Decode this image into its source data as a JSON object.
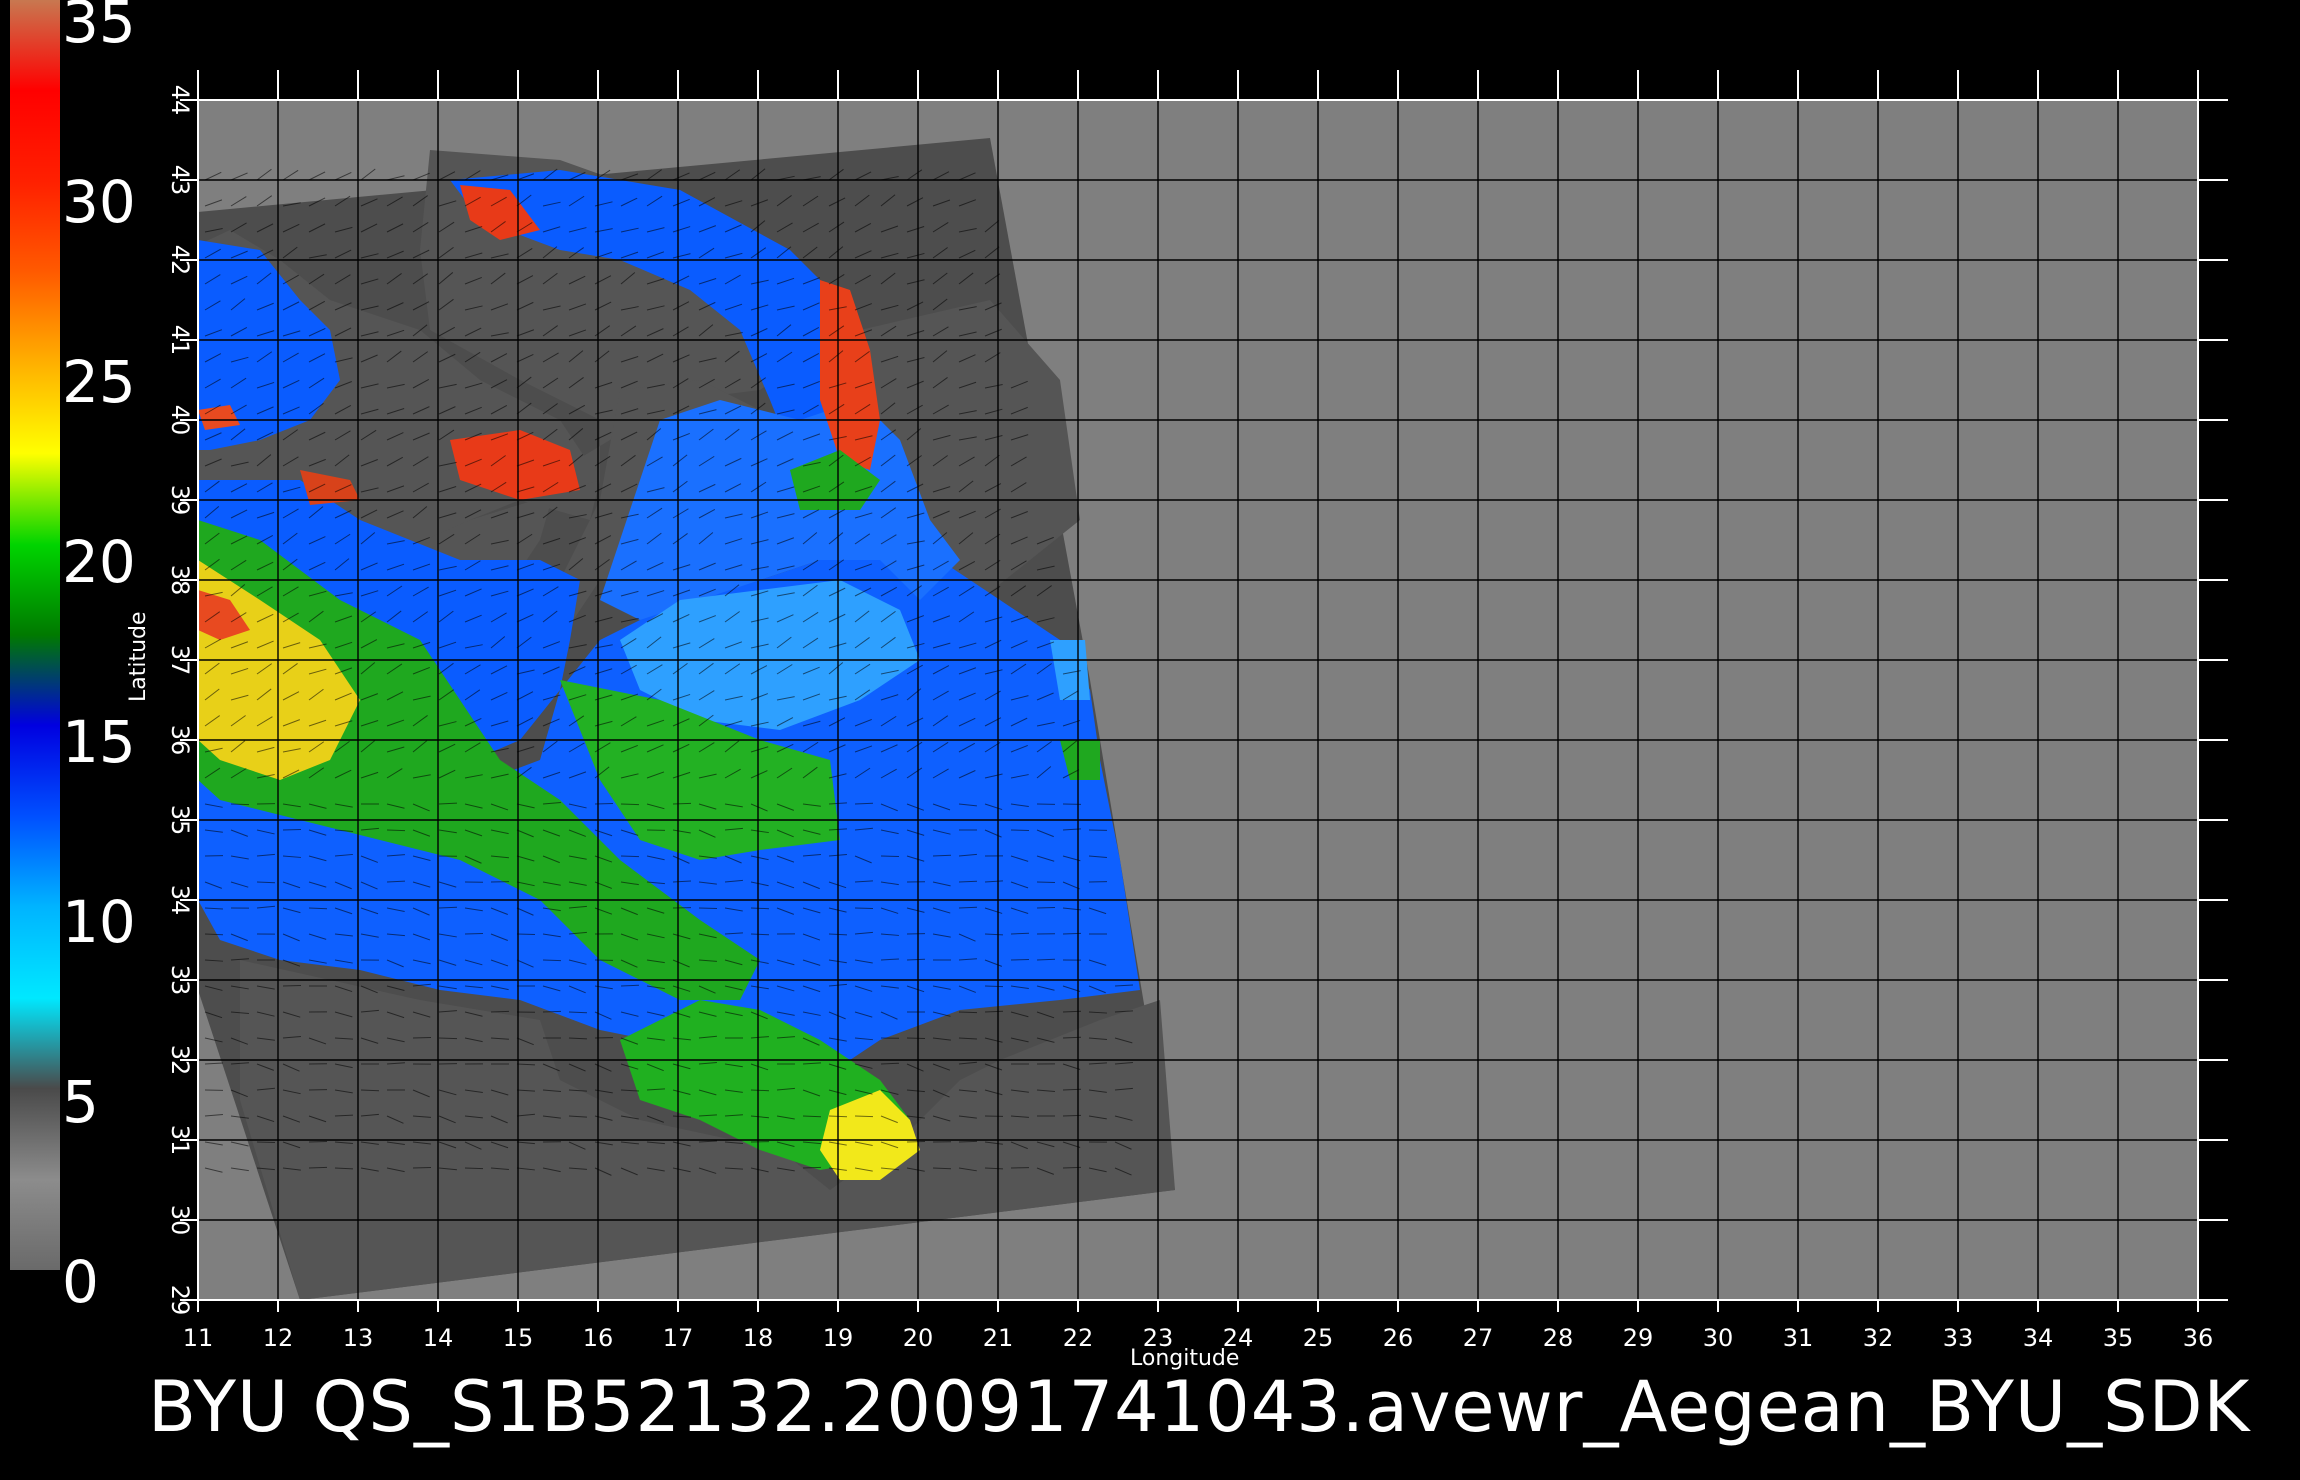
{
  "colorbar": {
    "labels": [
      "35",
      "30",
      "25",
      "20",
      "15",
      "10",
      "5",
      "0"
    ],
    "stops": [
      "#6a6a6a",
      "#8c8c8c",
      "#4a4a4a",
      "#00e8ff",
      "#00b4ff",
      "#0050ff",
      "#0000e0",
      "#007a00",
      "#00d400",
      "#ffff00",
      "#ffb000",
      "#ff5a00",
      "#ff2000",
      "#ff0000",
      "#c87850"
    ]
  },
  "axes": {
    "xlabel": "Longitude",
    "ylabel": "Latitude",
    "xticks": [
      "11",
      "12",
      "13",
      "14",
      "15",
      "16",
      "17",
      "18",
      "19",
      "20",
      "21",
      "22",
      "23",
      "24",
      "25",
      "26",
      "27",
      "28",
      "29",
      "30",
      "31",
      "32",
      "33",
      "34",
      "35",
      "36"
    ],
    "yticks": [
      "29",
      "30",
      "31",
      "32",
      "33",
      "34",
      "35",
      "36",
      "37",
      "38",
      "39",
      "40",
      "41",
      "42",
      "43",
      "44"
    ],
    "xlim": [
      11,
      36
    ],
    "ylim": [
      29,
      44
    ]
  },
  "footer": "BYU  QS_S1B52132.20091741043.avewr_Aegean_BYU_SDK",
  "colors": {
    "background": "#000000",
    "map_bg": "#7f7f7f",
    "swath": "#4d4d4d",
    "land": "#555555",
    "grid": "#000000"
  }
}
